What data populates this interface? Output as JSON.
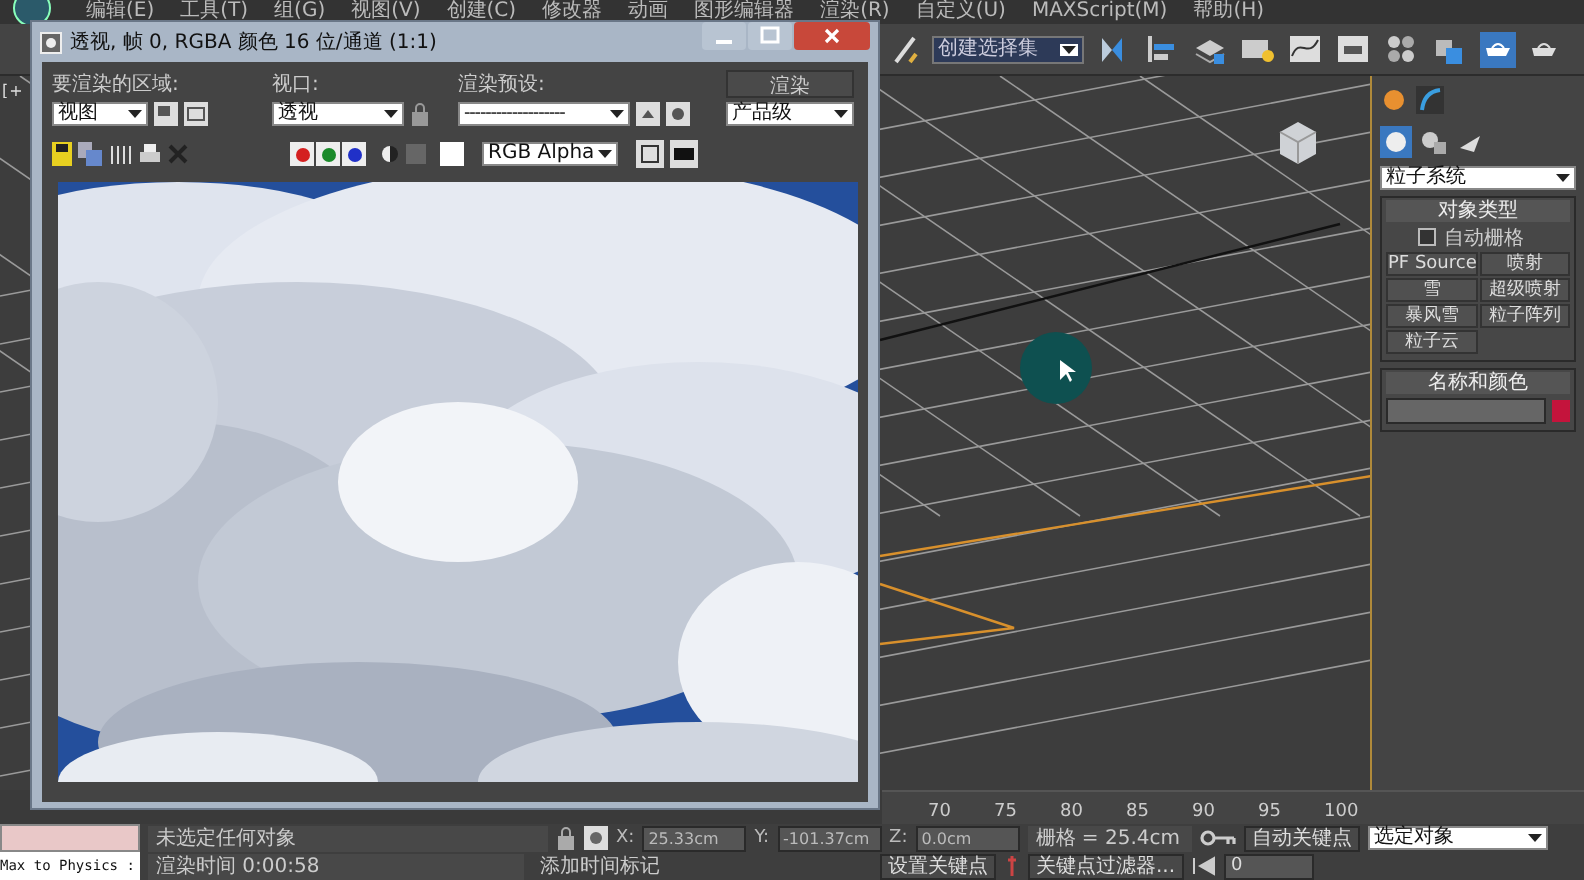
{
  "menu": [
    {
      "label": "编辑(E)"
    },
    {
      "label": "工具(T)"
    },
    {
      "label": "组(G)"
    },
    {
      "label": "视图(V)"
    },
    {
      "label": "创建(C)"
    },
    {
      "label": "修改器"
    },
    {
      "label": "动画"
    },
    {
      "label": "图形编辑器"
    },
    {
      "label": "渲染(R)"
    },
    {
      "label": "自定义(U)"
    },
    {
      "label": "MAXScript(M)"
    },
    {
      "label": "帮助(H)"
    }
  ],
  "toolbar": {
    "selection_set": "创建选择集"
  },
  "viewport": {
    "label": "[ +"
  },
  "render_window": {
    "title": "透视, 帧 0, RGBA 颜色 16 位/通道 (1:1)",
    "area_label": "要渲染的区域:",
    "area": "视图",
    "viewport_label": "视口:",
    "viewport": "透视",
    "preset_label": "渲染预设:",
    "preset": "-------------------",
    "render_button": "渲染",
    "quality": "产品级",
    "channels": [
      {
        "color": "#d42020"
      },
      {
        "color": "#1a8a2a"
      },
      {
        "color": "#2030c8"
      }
    ],
    "display": "RGB Alpha"
  },
  "command_panel": {
    "category": "粒子系统",
    "object_type_title": "对象类型",
    "auto_grid": {
      "label": "自动栅格",
      "checked": false
    },
    "buttons": [
      {
        "label": "PF Source"
      },
      {
        "label": "喷射"
      },
      {
        "label": "雪"
      },
      {
        "label": "超级喷射"
      },
      {
        "label": "暴风雪"
      },
      {
        "label": "粒子阵列"
      },
      {
        "label": "粒子云"
      }
    ],
    "name_color_title": "名称和颜色",
    "swatch": {
      "color": "#c4143c"
    }
  },
  "timeline": {
    "ticks": [
      "70",
      "75",
      "80",
      "85",
      "90",
      "95",
      "100"
    ]
  },
  "status": {
    "plugin": "Max to Physics :",
    "selection": "未选定任何对象",
    "render_time": "渲染时间 0:00:58",
    "x_label": "X:",
    "x": "25.33cm",
    "y_label": "Y:",
    "y": "-101.37cm",
    "z_label": "Z:",
    "z": "0.0cm",
    "grid": "栅格 = 25.4cm",
    "add_time_tag": "添加时间标记",
    "auto_key": "自动关键点",
    "key_mode": "选定对象",
    "set_key": "设置关键点",
    "key_filters": "关键点过滤器...",
    "frame": "0"
  }
}
